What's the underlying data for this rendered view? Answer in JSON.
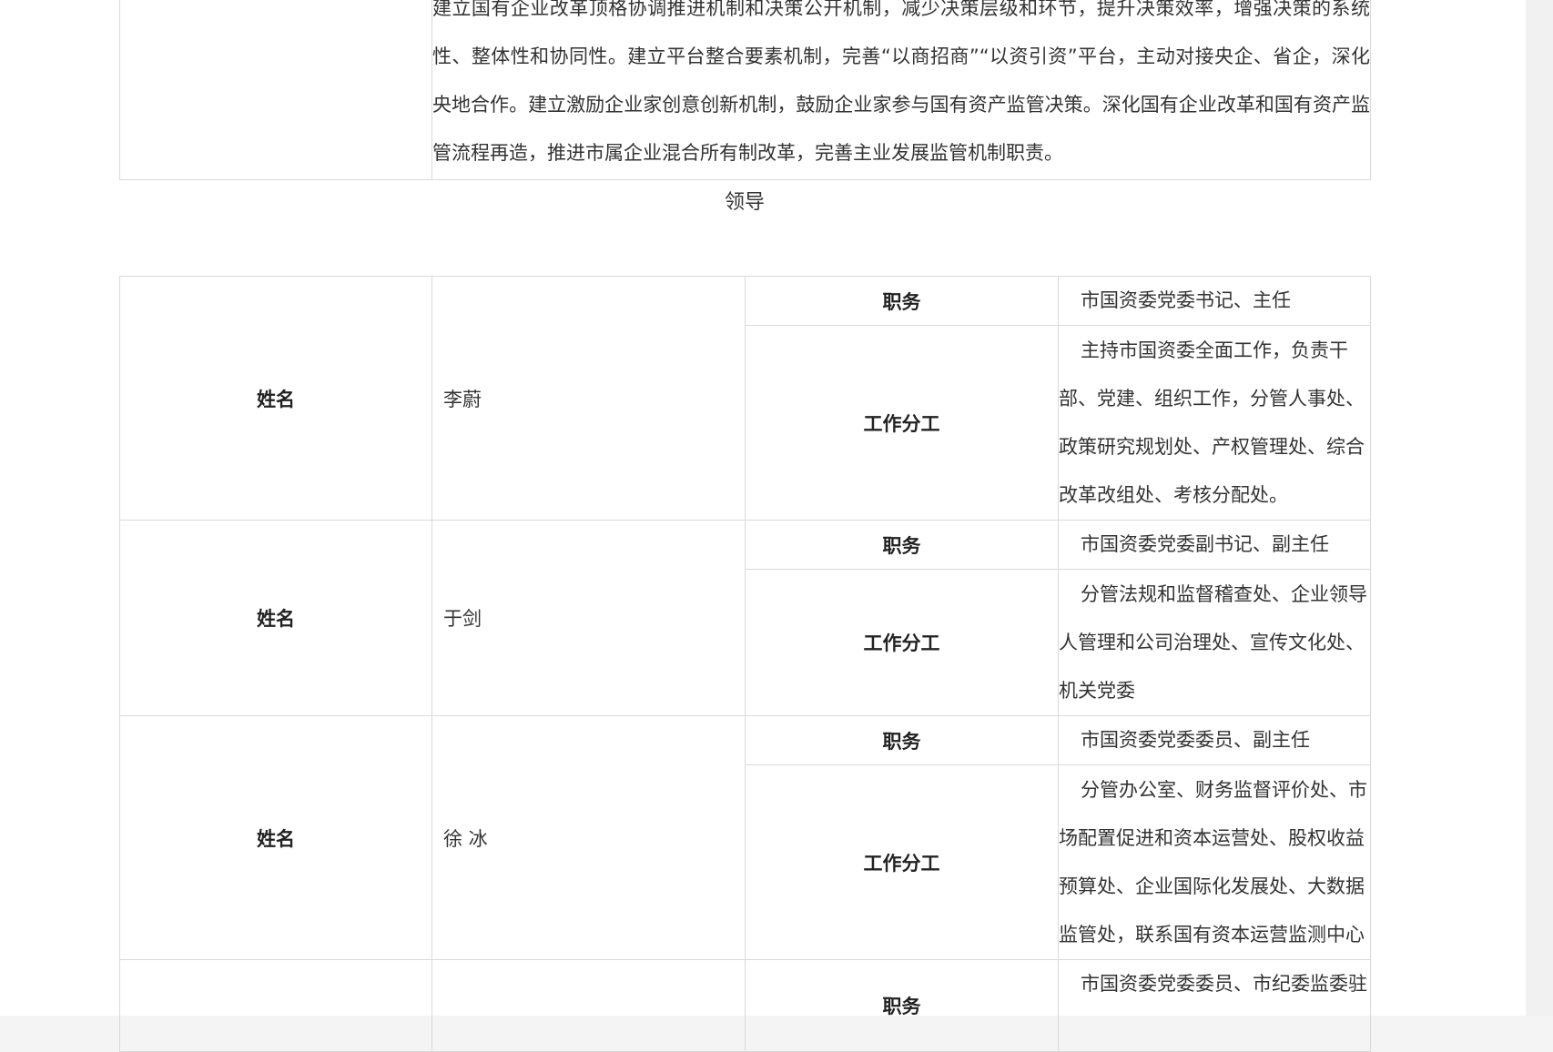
{
  "intro": {
    "text": " 建立国有企业改革顶格协调推进机制和决策公开机制，减少决策层级和环节，提升决策效率，增强决策的系统性、整体性和协同性。建立平台整合要素机制，完善“以商招商”“以资引资”平台，主动对接央企、省企，深化央地合作。建立激励企业家创意创新机制，鼓励企业家参与国有资产监管决策。深化国有企业改革和国有资产监管流程再造，推进市属企业混合所有制改革，完善主业发展监管机制职责。"
  },
  "section_title": "领导",
  "labels": {
    "name": "姓名",
    "position": "职务",
    "duties": "工作分工"
  },
  "leaders": [
    {
      "name": "李蔚",
      "position": "市国资委党委书记、主任",
      "duties": "主持市国资委全面工作，负责干部、党建、组织工作，分管人事处、政策研究规划处、产权管理处、综合改革改组处、考核分配处。"
    },
    {
      "name": "于剑",
      "position": "市国资委党委副书记、副主任",
      "duties": "分管法规和监督稽查处、企业领导人管理和公司治理处、宣传文化处、机关党委"
    },
    {
      "name": "徐 冰",
      "position": "市国资委党委委员、副主任",
      "duties": "分管办公室、财务监督评价处、市场配置促进和资本运营处、股权收益预算处、企业国际化发展处、大数据监管处，联系国有资本运营监测中心"
    },
    {
      "name": "",
      "position": "市国资委党委委员、市纪委监委驻",
      "duties": ""
    }
  ]
}
